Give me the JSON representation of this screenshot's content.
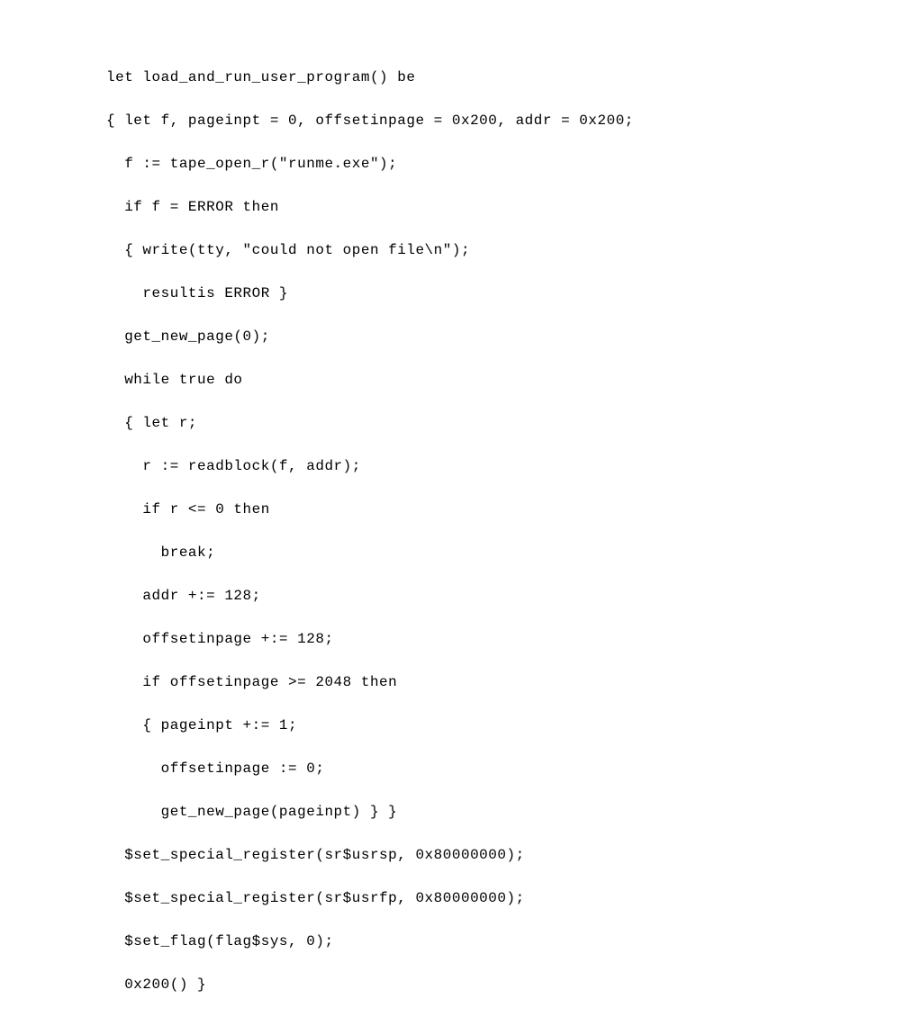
{
  "code": {
    "lines": [
      "let load_and_run_user_program() be",
      "{ let f, pageinpt = 0, offsetinpage = 0x200, addr = 0x200;",
      "  f := tape_open_r(\"runme.exe\");",
      "  if f = ERROR then",
      "  { write(tty, \"could not open file\\n\");",
      "    resultis ERROR }",
      "  get_new_page(0);",
      "  while true do",
      "  { let r;",
      "    r := readblock(f, addr);",
      "    if r <= 0 then",
      "      break;",
      "    addr +:= 128;",
      "    offsetinpage +:= 128;",
      "    if offsetinpage >= 2048 then",
      "    { pageinpt +:= 1;",
      "      offsetinpage := 0;",
      "      get_new_page(pageinpt) } }",
      "  $set_special_register(sr$usrsp, 0x80000000);",
      "  $set_special_register(sr$usrfp, 0x80000000);",
      "  $set_flag(flag$sys, 0);",
      "  0x200() }"
    ]
  }
}
